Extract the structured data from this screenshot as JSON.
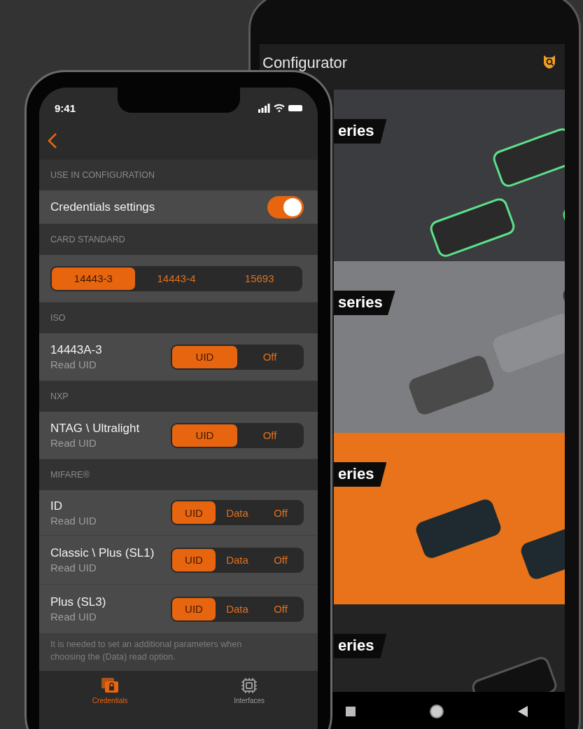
{
  "back_phone": {
    "title": "Configurator",
    "banners": [
      {
        "label": "eries",
        "color": "#3b3c40"
      },
      {
        "label": "series",
        "color": "#7d7e82"
      },
      {
        "label": "eries",
        "color": "#e8731a"
      },
      {
        "label": "eries",
        "color": "#242424"
      }
    ]
  },
  "front_phone": {
    "time": "9:41",
    "sections": [
      {
        "header": "USE IN CONFIGURATION",
        "rows": [
          {
            "kind": "toggle",
            "label": "Credentials settings",
            "on": true
          }
        ]
      },
      {
        "header": "CARD STANDARD",
        "rows": [
          {
            "kind": "segmented",
            "options": [
              {
                "label": "14443-3",
                "selected": true
              },
              {
                "label": "14443-4",
                "selected": false
              },
              {
                "label": "15693",
                "selected": false
              }
            ]
          }
        ]
      },
      {
        "header": "ISO",
        "rows": [
          {
            "kind": "option",
            "label": "14443A-3",
            "sublabel": "Read UID",
            "options": [
              {
                "label": "UID",
                "selected": true
              },
              {
                "label": "Off",
                "selected": false
              }
            ]
          }
        ]
      },
      {
        "header": "NXP",
        "rows": [
          {
            "kind": "option",
            "label": "NTAG \\ Ultralight",
            "sublabel": "Read UID",
            "options": [
              {
                "label": "UID",
                "selected": true
              },
              {
                "label": "Off",
                "selected": false
              }
            ]
          }
        ]
      },
      {
        "header": "MIFARE®",
        "rows": [
          {
            "kind": "option",
            "label": "ID",
            "sublabel": "Read UID",
            "options": [
              {
                "label": "UID",
                "selected": true
              },
              {
                "label": "Data",
                "selected": false
              },
              {
                "label": "Off",
                "selected": false
              }
            ]
          },
          {
            "kind": "option",
            "label": "Classic \\ Plus (SL1)",
            "sublabel": "Read UID",
            "options": [
              {
                "label": "UID",
                "selected": true
              },
              {
                "label": "Data",
                "selected": false
              },
              {
                "label": "Off",
                "selected": false
              }
            ]
          },
          {
            "kind": "option",
            "label": "Plus (SL3)",
            "sublabel": "Read UID",
            "options": [
              {
                "label": "UID",
                "selected": true
              },
              {
                "label": "Data",
                "selected": false
              },
              {
                "label": "Off",
                "selected": false
              }
            ]
          }
        ]
      }
    ],
    "note": "It is needed to set an additional parameters when choosing the (Data) read option.",
    "tabs": [
      {
        "label": "Credentials",
        "kind": "cards",
        "selected": true
      },
      {
        "label": "Interfaces",
        "kind": "chip",
        "selected": false
      }
    ]
  }
}
